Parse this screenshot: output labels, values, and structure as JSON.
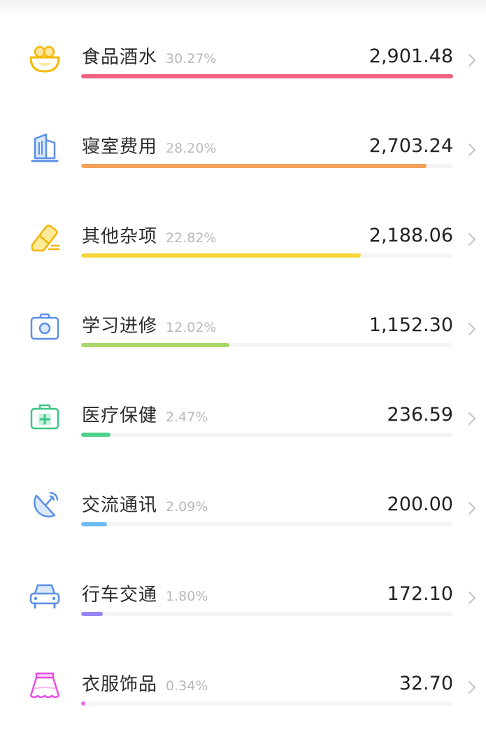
{
  "categories": [
    {
      "name": "食品酒水",
      "percent": "30.27%",
      "amount": "2,901.48",
      "share": 1.0,
      "color": "#f0617f",
      "icon": "food-bowl-icon"
    },
    {
      "name": "寝室费用",
      "percent": "28.20%",
      "amount": "2,703.24",
      "share": 0.929,
      "color": "#f4a259",
      "icon": "dorm-building-icon"
    },
    {
      "name": "其他杂项",
      "percent": "22.82%",
      "amount": "2,188.06",
      "share": 0.752,
      "color": "#f7d53a",
      "icon": "eraser-misc-icon"
    },
    {
      "name": "学习进修",
      "percent": "12.02%",
      "amount": "1,152.30",
      "share": 0.398,
      "color": "#a8d86a",
      "icon": "camera-study-icon"
    },
    {
      "name": "医疗保健",
      "percent": "2.47%",
      "amount": "236.59",
      "share": 0.079,
      "color": "#4fd08c",
      "icon": "medical-kit-icon"
    },
    {
      "name": "交流通讯",
      "percent": "2.09%",
      "amount": "200.00",
      "share": 0.069,
      "color": "#6cbaf4",
      "icon": "satellite-dish-icon"
    },
    {
      "name": "行车交通",
      "percent": "1.80%",
      "amount": "172.10",
      "share": 0.058,
      "color": "#9588f2",
      "icon": "car-icon"
    },
    {
      "name": "衣服饰品",
      "percent": "0.34%",
      "amount": "32.70",
      "share": 0.011,
      "color": "#e86ae6",
      "icon": "skirt-icon"
    }
  ]
}
